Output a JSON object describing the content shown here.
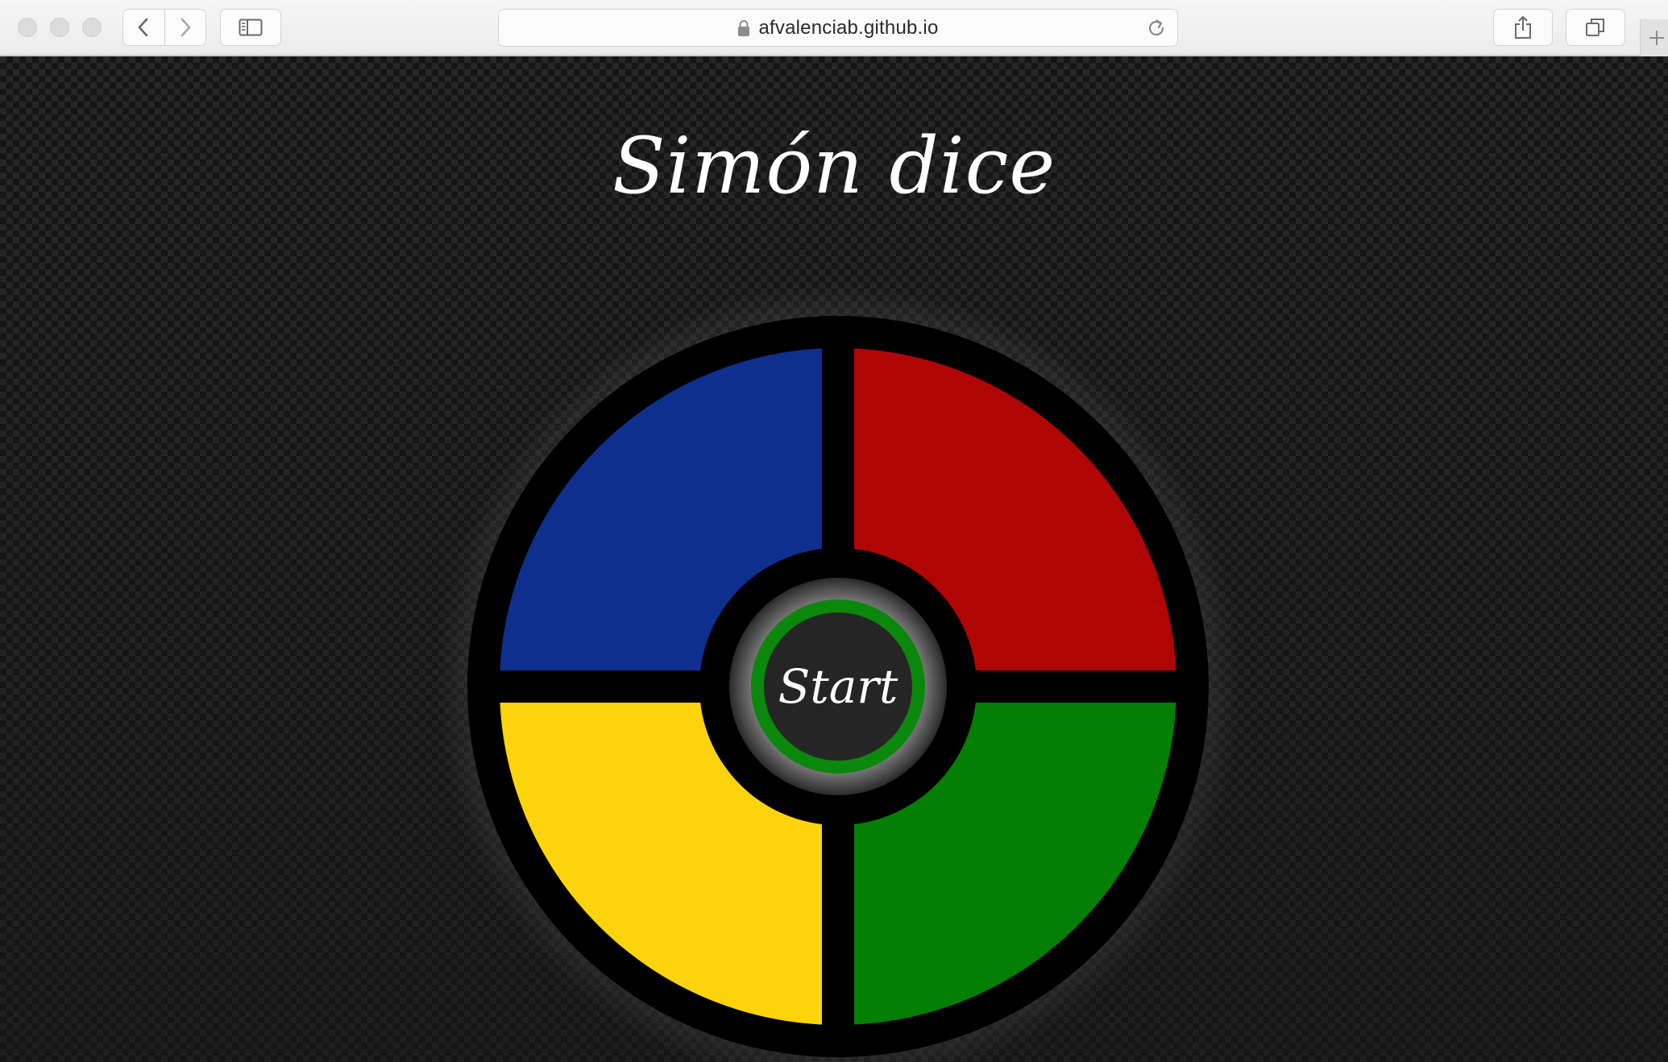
{
  "browser": {
    "url": "afvalenciab.github.io",
    "icons": {
      "back": "chevron-left-icon",
      "forward": "chevron-right-icon",
      "sidebar": "sidebar-icon",
      "lock": "lock-icon",
      "reload": "reload-icon",
      "share": "share-icon",
      "tabs": "tabs-overview-icon",
      "new_tab": "plus-icon"
    }
  },
  "game": {
    "title": "Simón dice",
    "start_label": "Start",
    "colors": {
      "top_left": "#0f2f8f",
      "top_right": "#b00505",
      "bottom_left": "#fcd40d",
      "bottom_right": "#037f03",
      "start_ring": "#0b870b",
      "frame": "#000000"
    }
  }
}
